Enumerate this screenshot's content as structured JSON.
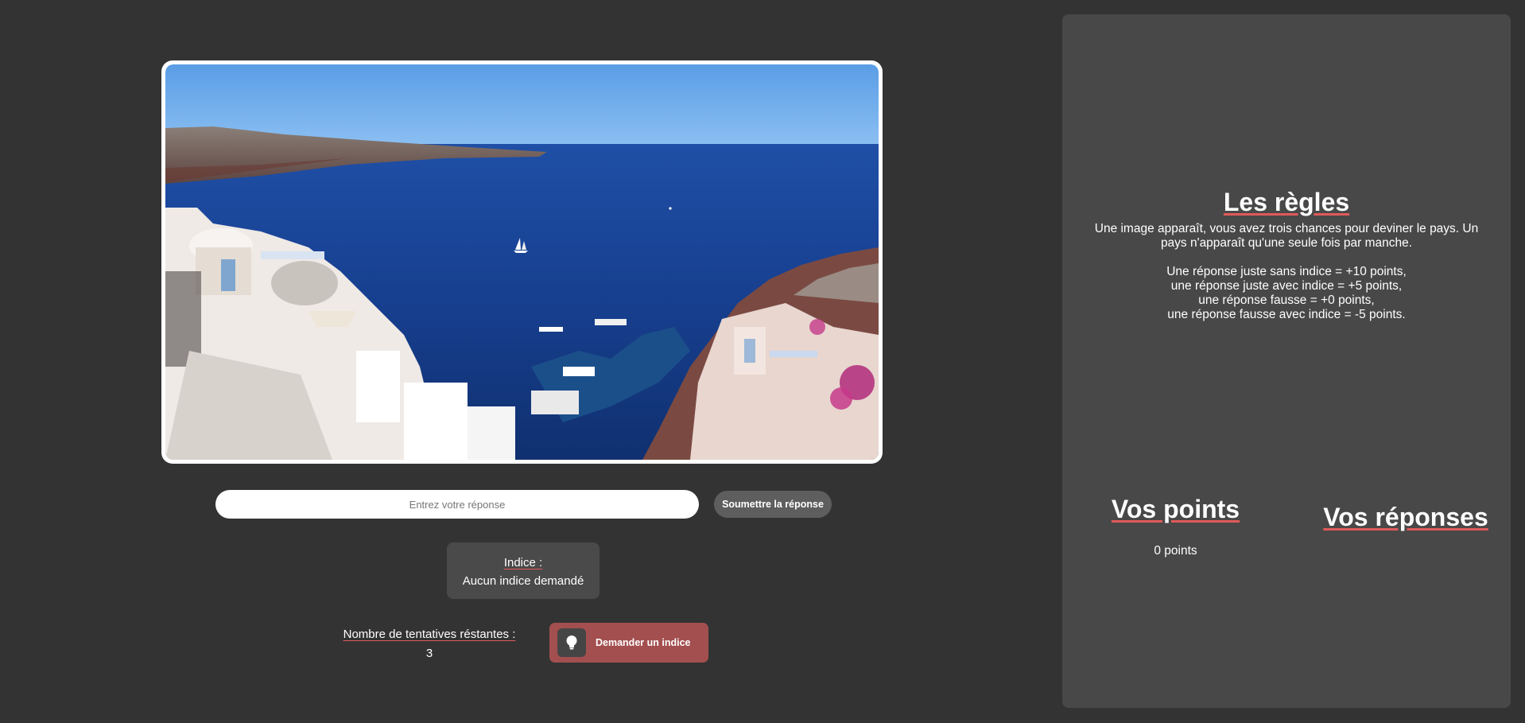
{
  "game": {
    "answer_placeholder": "Entrez votre réponse",
    "answer_value": "",
    "submit_label": "Soumettre la réponse",
    "hint_title": "Indice :",
    "hint_text": "Aucun indice demandé",
    "tries_label": "Nombre de tentatives réstantes :",
    "tries_value": "3",
    "hint_button_label": "Demander un indice",
    "hint_button_icon": "lightbulb-icon"
  },
  "rules": {
    "title": "Les règles",
    "intro": "Une image apparaît, vous avez trois chances pour deviner le pays. Un pays n'apparaît qu'une seule fois par manche.",
    "scoring": [
      "Une réponse juste sans indice = +10 points,",
      "une réponse juste avec indice = +5 points,",
      "une réponse fausse = +0 points,",
      "une réponse fausse avec indice = -5 points."
    ]
  },
  "score": {
    "title": "Vos points",
    "value": "0 points"
  },
  "answers": {
    "title": "Vos réponses",
    "items": []
  },
  "colors": {
    "page_background": "#333333",
    "panel_background": "#484848",
    "hint_button": "#a34f4f",
    "submit_button": "#5e5e5e",
    "underline_accent": "#e05a5a"
  }
}
